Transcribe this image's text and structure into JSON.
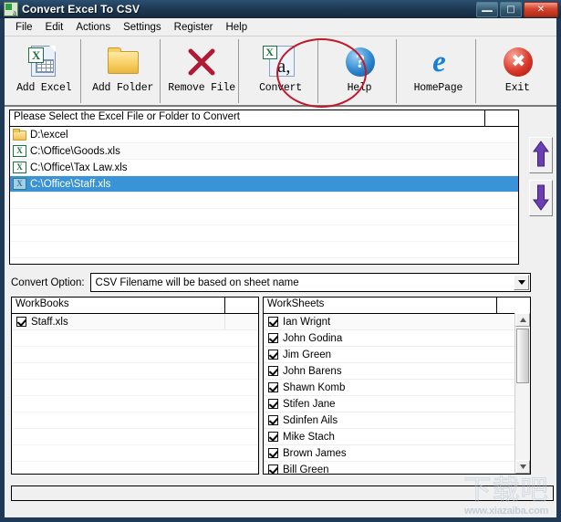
{
  "window": {
    "title": "Convert Excel To CSV",
    "icon": "app-icon",
    "controls": {
      "minimize": "—",
      "maximize": "□",
      "close": "✕"
    }
  },
  "menu": {
    "items": [
      {
        "label": "File"
      },
      {
        "label": "Edit"
      },
      {
        "label": "Actions"
      },
      {
        "label": "Settings"
      },
      {
        "label": "Register"
      },
      {
        "label": "Help"
      }
    ]
  },
  "toolbar": {
    "buttons": [
      {
        "label": "Add Excel",
        "icon": "excel-document-icon"
      },
      {
        "label": "Add Folder",
        "icon": "folder-icon"
      },
      {
        "label": "Remove File",
        "icon": "red-cross-icon"
      },
      {
        "label": "Convert",
        "icon": "convert-document-icon"
      },
      {
        "label": "Help",
        "icon": "question-mark-icon"
      },
      {
        "label": "HomePage",
        "icon": "internet-explorer-icon"
      },
      {
        "label": "Exit",
        "icon": "red-circle-cross-icon"
      }
    ],
    "annotation": {
      "target": "Convert",
      "shape": "ellipse",
      "color": "#c0192b"
    }
  },
  "file_list": {
    "header": "Please Select the Excel File or Folder to Convert",
    "rows": [
      {
        "path": "D:\\excel",
        "icon": "folder-icon",
        "selected": false
      },
      {
        "path": "C:\\Office\\Goods.xls",
        "icon": "excel-file-icon",
        "selected": false
      },
      {
        "path": "C:\\Office\\Tax Law.xls",
        "icon": "excel-file-icon",
        "selected": false
      },
      {
        "path": "C:\\Office\\Staff.xls",
        "icon": "excel-file-icon",
        "selected": true
      }
    ],
    "selection_color": "#3a93d6"
  },
  "move_buttons": {
    "up": "move-up-arrow",
    "down": "move-down-arrow",
    "color": "#6a3fb5"
  },
  "convert_option": {
    "label": "Convert Option:",
    "value": "CSV Filename will be based on sheet name",
    "arrow": "▼"
  },
  "workbooks": {
    "header": "WorkBooks",
    "items": [
      {
        "name": "Staff.xls",
        "checked": true
      }
    ]
  },
  "worksheets": {
    "header": "WorkSheets",
    "items": [
      {
        "name": "Ian Wrignt",
        "checked": true
      },
      {
        "name": "John Godina",
        "checked": true
      },
      {
        "name": "Jim Green",
        "checked": true
      },
      {
        "name": "John Barens",
        "checked": true
      },
      {
        "name": "Shawn Komb",
        "checked": true
      },
      {
        "name": "Stifen Jane",
        "checked": true
      },
      {
        "name": "Sdinfen Ails",
        "checked": true
      },
      {
        "name": "Mike Stach",
        "checked": true
      },
      {
        "name": "Brown James",
        "checked": true
      },
      {
        "name": "Bill Green",
        "checked": true
      }
    ],
    "scrollbar": {
      "up_arrow": "▲",
      "down_arrow": "▼"
    }
  },
  "status_bar": {
    "text": ""
  },
  "watermark": {
    "cjk": "下载吧",
    "url": "www.xiazaiba.com"
  }
}
